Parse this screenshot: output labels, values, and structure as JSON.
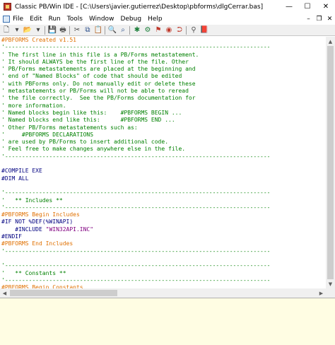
{
  "window": {
    "title": "Classic PB/Win IDE - [C:\\Users\\javier.gutierrez\\Desktop\\pbforms\\dlgCerrar.bas]",
    "controls": [
      "—",
      "☐",
      "✕"
    ]
  },
  "menu": {
    "items": [
      "File",
      "Edit",
      "Run",
      "Tools",
      "Window",
      "Debug",
      "Help"
    ],
    "mdi_controls": [
      "–",
      "❐",
      "✕"
    ]
  },
  "toolbar": {
    "buttons": [
      {
        "icon": "new-file-icon",
        "glyph": "🗋",
        "color": "#444444"
      },
      {
        "icon": "dropdown-arrow-icon",
        "glyph": "▾",
        "color": "#444444"
      },
      {
        "icon": "open-folder-icon",
        "glyph": "📂",
        "color": "#d8a520"
      },
      {
        "icon": "dropdown-arrow-icon",
        "glyph": "▾",
        "color": "#444444"
      },
      {
        "icon": "save-icon",
        "glyph": "💾",
        "color": "#2b4f8c"
      },
      {
        "icon": "print-icon",
        "glyph": "🖶",
        "color": "#555555"
      },
      {
        "icon": "cut-icon",
        "glyph": "✂",
        "color": "#444444"
      },
      {
        "icon": "copy-icon",
        "glyph": "⧉",
        "color": "#2b4f8c"
      },
      {
        "icon": "paste-icon",
        "glyph": "📋",
        "color": "#a0742a"
      },
      {
        "icon": "find-icon",
        "glyph": "🔍",
        "color": "#2b4f8c"
      },
      {
        "icon": "find-next-icon",
        "glyph": "⌕",
        "color": "#2b4f8c"
      },
      {
        "icon": "compile-icon",
        "glyph": "✱",
        "color": "#1c7f3a"
      },
      {
        "icon": "compile-run-icon",
        "glyph": "⚙",
        "color": "#1c7f3a"
      },
      {
        "icon": "debug-icon",
        "glyph": "⚑",
        "color": "#c0392b"
      },
      {
        "icon": "stop-icon",
        "glyph": "◉",
        "color": "#c0392b"
      },
      {
        "icon": "run-icon",
        "glyph": "⮊",
        "color": "#c0392b"
      },
      {
        "icon": "bookmark-icon",
        "glyph": "⚲",
        "color": "#555555"
      },
      {
        "icon": "help-book-icon",
        "glyph": "📕",
        "color": "#8b1a1a"
      }
    ],
    "separators_after": [
      3,
      5,
      8,
      10,
      15
    ]
  },
  "editor": {
    "lines": [
      {
        "t": "#PBFORMS Created v1.51",
        "c": "p"
      },
      {
        "t": "'------------------------------------------------------------------------------",
        "c": "c"
      },
      {
        "t": "' The first line in this file is a PB/Forms metastatement.",
        "c": "c"
      },
      {
        "t": "' It should ALWAYS be the first line of the file. Other",
        "c": "c"
      },
      {
        "t": "' PB/Forms metastatements are placed at the beginning and",
        "c": "c"
      },
      {
        "t": "' end of \"Named Blocks\" of code that should be edited",
        "c": "c"
      },
      {
        "t": "' with PBForms only. Do not manually edit or delete these",
        "c": "c"
      },
      {
        "t": "' metastatements or PB/Forms will not be able to reread",
        "c": "c"
      },
      {
        "t": "' the file correctly.  See the PB/Forms documentation for",
        "c": "c"
      },
      {
        "t": "' more information.",
        "c": "c"
      },
      {
        "t": "' Named blocks begin like this:    #PBFORMS BEGIN ...",
        "c": "c"
      },
      {
        "t": "' Named blocks end like this:      #PBFORMS END ...",
        "c": "c"
      },
      {
        "t": "' Other PB/Forms metastatements such as:",
        "c": "c"
      },
      {
        "t": "'     #PBFORMS DECLARATIONS",
        "c": "c"
      },
      {
        "t": "' are used by PB/Forms to insert additional code.",
        "c": "c"
      },
      {
        "t": "' Feel free to make changes anywhere else in the file.",
        "c": "c"
      },
      {
        "t": "'------------------------------------------------------------------------------",
        "c": "c"
      },
      {
        "t": "",
        "c": "c"
      },
      {
        "t": "#COMPILE EXE",
        "c": "d"
      },
      {
        "t": "#DIM ALL",
        "c": "d"
      },
      {
        "t": "",
        "c": "c"
      },
      {
        "t": "'------------------------------------------------------------------------------",
        "c": "c"
      },
      {
        "t": "'   ** Includes **",
        "c": "c"
      },
      {
        "t": "'------------------------------------------------------------------------------",
        "c": "c"
      },
      {
        "t": "#PBFORMS Begin Includes",
        "c": "p"
      },
      {
        "t": "#IF NOT %DEF(%WINAPI)",
        "c": "d"
      },
      {
        "t": "    #INCLUDE ",
        "c": "d",
        "s": "\"WIN32API.INC\""
      },
      {
        "t": "#ENDIF",
        "c": "d"
      },
      {
        "t": "#PBFORMS End Includes",
        "c": "p"
      },
      {
        "t": "'------------------------------------------------------------------------------",
        "c": "c"
      },
      {
        "t": "",
        "c": "c"
      },
      {
        "t": "'------------------------------------------------------------------------------",
        "c": "c"
      },
      {
        "t": "'   ** Constants **",
        "c": "c"
      },
      {
        "t": "'------------------------------------------------------------------------------",
        "c": "c"
      },
      {
        "t": "#PBFORMS Begin Constants",
        "c": "p"
      }
    ]
  },
  "scrollbars": {
    "vertical": {
      "up": "▲",
      "down": "▼"
    },
    "horizontal": {
      "left": "◀",
      "right": "▶"
    }
  }
}
